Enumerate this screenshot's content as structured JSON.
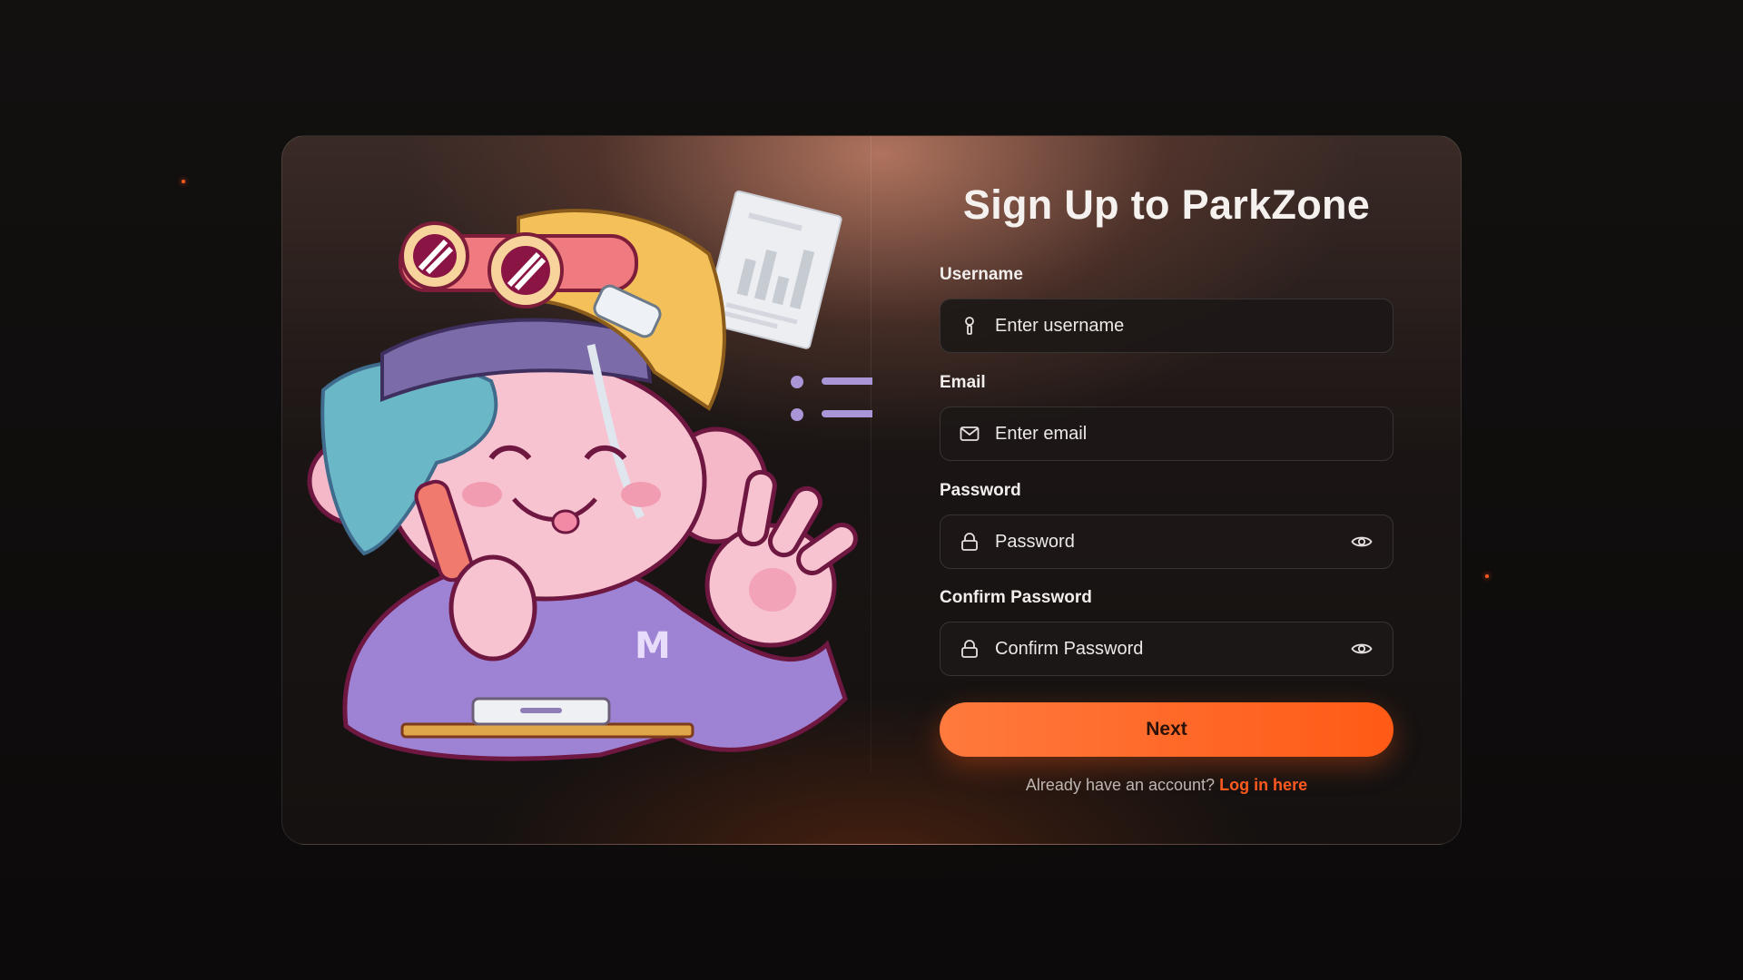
{
  "form": {
    "title": "Sign Up to ParkZone",
    "username": {
      "label": "Username",
      "placeholder": "Enter username",
      "icon": "key-icon"
    },
    "email": {
      "label": "Email",
      "placeholder": "Enter email",
      "icon": "mail-icon"
    },
    "password": {
      "label": "Password",
      "placeholder": "Password",
      "icon": "lock-icon",
      "toggle_icon": "eye-icon"
    },
    "confirm_password": {
      "label": "Confirm Password",
      "placeholder": "Confirm Password",
      "icon": "lock-icon",
      "toggle_icon": "eye-icon"
    },
    "next_label": "Next",
    "footer_text": "Already have an account?",
    "login_link": "Log in here"
  },
  "illustration": {
    "badge_letter": "M"
  },
  "colors": {
    "accent": "#ff5a1f",
    "background": "#0d0b0b",
    "field_bg": "#1c1817"
  }
}
